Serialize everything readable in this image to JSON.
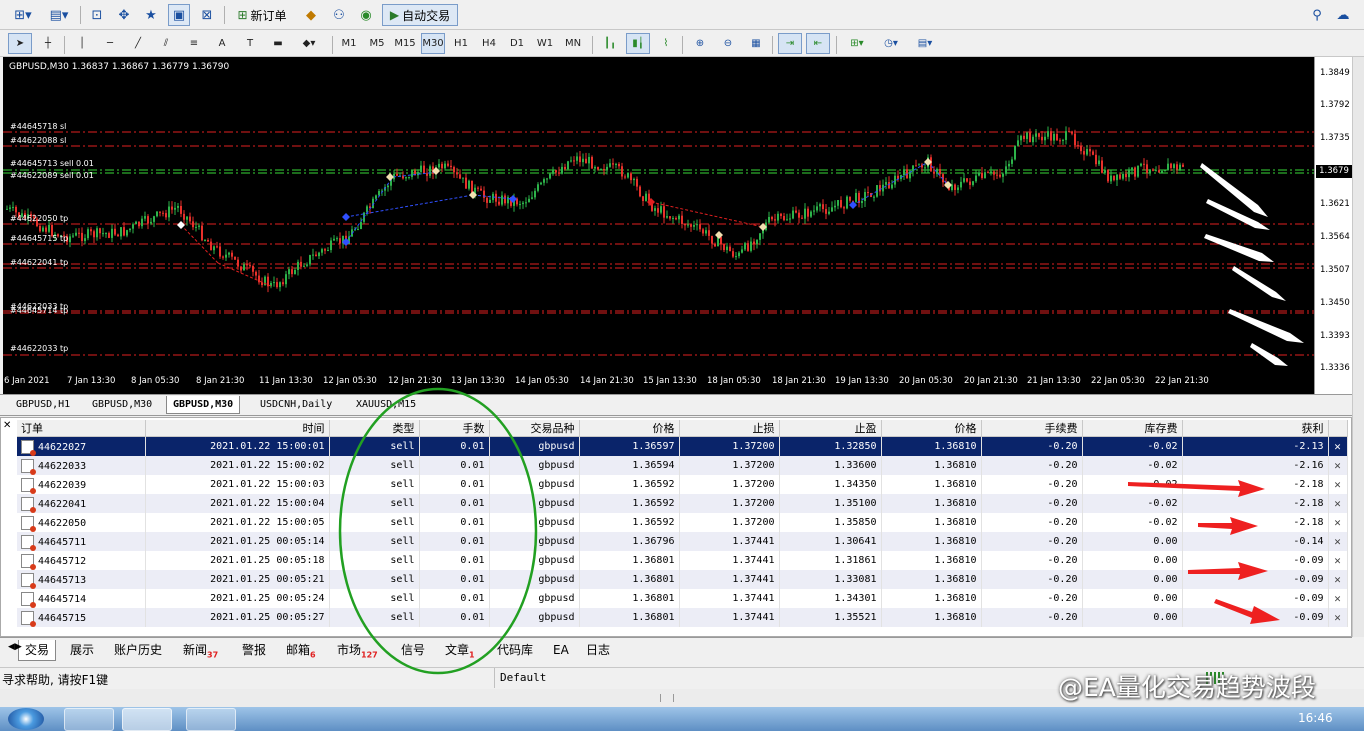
{
  "toolbar": {
    "new_order_label": "新订单",
    "auto_trading_label": "自动交易",
    "timeframes": [
      "M1",
      "M5",
      "M15",
      "M30",
      "H1",
      "H4",
      "D1",
      "W1",
      "MN"
    ],
    "selected_timeframe": "M30"
  },
  "chart": {
    "title": "GBPUSD,M30  1.36837 1.36867 1.36779 1.36790",
    "order_labels": [
      "#44645718 sl",
      "#44622088 sl",
      "#44645713 sell 0.01",
      "#44622089 sell 0.01",
      "#44622050 tp",
      "#44645715 tp",
      "#44622041 tp",
      "#44622033 tp",
      "#44645714 tp",
      "#44622033 tp"
    ],
    "price_labels": [
      "1.3849",
      "1.3792",
      "1.3735",
      "1.3679",
      "1.3621",
      "1.3564",
      "1.3507",
      "1.3450",
      "1.3393",
      "1.3336"
    ],
    "current_price": "1.3679",
    "time_labels": [
      "6 Jan 2021",
      "7 Jan 13:30",
      "8 Jan 05:30",
      "8 Jan 21:30",
      "11 Jan 13:30",
      "12 Jan 05:30",
      "12 Jan 21:30",
      "13 Jan 13:30",
      "14 Jan 05:30",
      "14 Jan 21:30",
      "15 Jan 13:30",
      "18 Jan 05:30",
      "18 Jan 21:30",
      "19 Jan 13:30",
      "20 Jan 05:30",
      "20 Jan 21:30",
      "21 Jan 13:30",
      "22 Jan 05:30",
      "22 Jan 21:30"
    ]
  },
  "chart_tabs": [
    "GBPUSD,H1",
    "GBPUSD,M30",
    "GBPUSD,M30",
    "USDCNH,Daily",
    "XAUUSD,M15"
  ],
  "active_chart_tab": 2,
  "terminal": {
    "columns": [
      "订单",
      "时间",
      "类型",
      "手数",
      "交易品种",
      "价格",
      "止损",
      "止盈",
      "价格",
      "手续费",
      "库存费",
      "获利"
    ],
    "orders": [
      [
        "44622027",
        "2021.01.22 15:00:01",
        "sell",
        "0.01",
        "gbpusd",
        "1.36597",
        "1.37200",
        "1.32850",
        "1.36810",
        "-0.20",
        "-0.02",
        "-2.13"
      ],
      [
        "44622033",
        "2021.01.22 15:00:02",
        "sell",
        "0.01",
        "gbpusd",
        "1.36594",
        "1.37200",
        "1.33600",
        "1.36810",
        "-0.20",
        "-0.02",
        "-2.16"
      ],
      [
        "44622039",
        "2021.01.22 15:00:03",
        "sell",
        "0.01",
        "gbpusd",
        "1.36592",
        "1.37200",
        "1.34350",
        "1.36810",
        "-0.20",
        "-0.02",
        "-2.18"
      ],
      [
        "44622041",
        "2021.01.22 15:00:04",
        "sell",
        "0.01",
        "gbpusd",
        "1.36592",
        "1.37200",
        "1.35100",
        "1.36810",
        "-0.20",
        "-0.02",
        "-2.18"
      ],
      [
        "44622050",
        "2021.01.22 15:00:05",
        "sell",
        "0.01",
        "gbpusd",
        "1.36592",
        "1.37200",
        "1.35850",
        "1.36810",
        "-0.20",
        "-0.02",
        "-2.18"
      ],
      [
        "44645711",
        "2021.01.25 00:05:14",
        "sell",
        "0.01",
        "gbpusd",
        "1.36796",
        "1.37441",
        "1.30641",
        "1.36810",
        "-0.20",
        "0.00",
        "-0.14"
      ],
      [
        "44645712",
        "2021.01.25 00:05:18",
        "sell",
        "0.01",
        "gbpusd",
        "1.36801",
        "1.37441",
        "1.31861",
        "1.36810",
        "-0.20",
        "0.00",
        "-0.09"
      ],
      [
        "44645713",
        "2021.01.25 00:05:21",
        "sell",
        "0.01",
        "gbpusd",
        "1.36801",
        "1.37441",
        "1.33081",
        "1.36810",
        "-0.20",
        "0.00",
        "-0.09"
      ],
      [
        "44645714",
        "2021.01.25 00:05:24",
        "sell",
        "0.01",
        "gbpusd",
        "1.36801",
        "1.37441",
        "1.34301",
        "1.36810",
        "-0.20",
        "0.00",
        "-0.09"
      ],
      [
        "44645715",
        "2021.01.25 00:05:27",
        "sell",
        "0.01",
        "gbpusd",
        "1.36801",
        "1.37441",
        "1.35521",
        "1.36810",
        "-0.20",
        "0.00",
        "-0.09"
      ]
    ],
    "selected_row": 0
  },
  "terminal_tabs": [
    {
      "label": "交易",
      "badge": ""
    },
    {
      "label": "展示",
      "badge": ""
    },
    {
      "label": "账户历史",
      "badge": ""
    },
    {
      "label": "新闻",
      "badge": "37"
    },
    {
      "label": "警报",
      "badge": ""
    },
    {
      "label": "邮箱",
      "badge": "6"
    },
    {
      "label": "市场",
      "badge": "127"
    },
    {
      "label": "信号",
      "badge": ""
    },
    {
      "label": "文章",
      "badge": "1"
    },
    {
      "label": "代码库",
      "badge": ""
    },
    {
      "label": "EA",
      "badge": ""
    },
    {
      "label": "日志",
      "badge": ""
    }
  ],
  "status": {
    "help_text": "寻求帮助, 请按F1键",
    "profile": "Default"
  },
  "watermark": "@EA量化交易趋势波段",
  "clock": "16:46",
  "colors": {
    "chart_bg": "#000000",
    "bull_candle": "#2db34a",
    "bear_candle": "#e8312b",
    "sl_line": "#e02020",
    "entry_line": "#38d838",
    "selected_row": "#0a246a",
    "annotation_red": "#ff2020",
    "annotation_green": "#22a022"
  }
}
